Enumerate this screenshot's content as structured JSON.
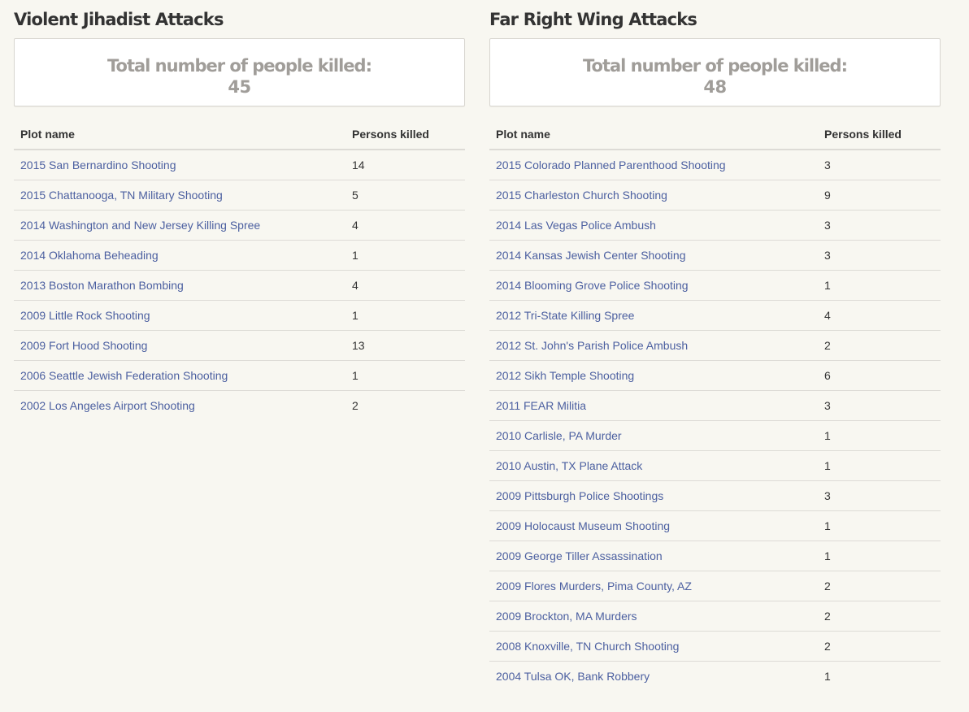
{
  "jihadist": {
    "title": "Violent Jihadist Attacks",
    "total_label": "Total number of people killed:",
    "total_value": "45",
    "columns": {
      "plot": "Plot name",
      "killed": "Persons killed"
    },
    "rows": [
      {
        "name": "2015 San Bernardino Shooting",
        "killed": "14"
      },
      {
        "name": "2015 Chattanooga, TN Military Shooting",
        "killed": "5"
      },
      {
        "name": "2014 Washington and New Jersey Killing Spree",
        "killed": "4"
      },
      {
        "name": "2014 Oklahoma Beheading",
        "killed": "1"
      },
      {
        "name": "2013 Boston Marathon Bombing",
        "killed": "4"
      },
      {
        "name": "2009 Little Rock Shooting",
        "killed": "1"
      },
      {
        "name": "2009 Fort Hood Shooting",
        "killed": "13"
      },
      {
        "name": "2006 Seattle Jewish Federation Shooting",
        "killed": "1"
      },
      {
        "name": "2002 Los Angeles Airport Shooting",
        "killed": "2"
      }
    ]
  },
  "farright": {
    "title": "Far Right Wing Attacks",
    "total_label": "Total number of people killed:",
    "total_value": "48",
    "columns": {
      "plot": "Plot name",
      "killed": "Persons killed"
    },
    "rows": [
      {
        "name": "2015 Colorado Planned Parenthood Shooting",
        "killed": "3"
      },
      {
        "name": "2015 Charleston Church Shooting",
        "killed": "9"
      },
      {
        "name": "2014 Las Vegas Police Ambush",
        "killed": "3"
      },
      {
        "name": "2014 Kansas Jewish Center Shooting",
        "killed": "3"
      },
      {
        "name": "2014 Blooming Grove Police Shooting",
        "killed": "1"
      },
      {
        "name": "2012 Tri-State Killing Spree",
        "killed": "4"
      },
      {
        "name": "2012 St. John's Parish Police Ambush",
        "killed": "2"
      },
      {
        "name": "2012 Sikh Temple Shooting",
        "killed": "6"
      },
      {
        "name": "2011 FEAR Militia",
        "killed": "3"
      },
      {
        "name": "2010 Carlisle, PA Murder",
        "killed": "1"
      },
      {
        "name": "2010 Austin, TX Plane Attack",
        "killed": "1"
      },
      {
        "name": "2009 Pittsburgh Police Shootings",
        "killed": "3"
      },
      {
        "name": "2009 Holocaust Museum Shooting",
        "killed": "1"
      },
      {
        "name": "2009 George Tiller Assassination",
        "killed": "1"
      },
      {
        "name": "2009 Flores Murders, Pima County, AZ",
        "killed": "2"
      },
      {
        "name": "2009 Brockton, MA Murders",
        "killed": "2"
      },
      {
        "name": "2008 Knoxville, TN Church Shooting",
        "killed": "2"
      },
      {
        "name": "2004 Tulsa OK, Bank Robbery",
        "killed": "1"
      }
    ]
  }
}
